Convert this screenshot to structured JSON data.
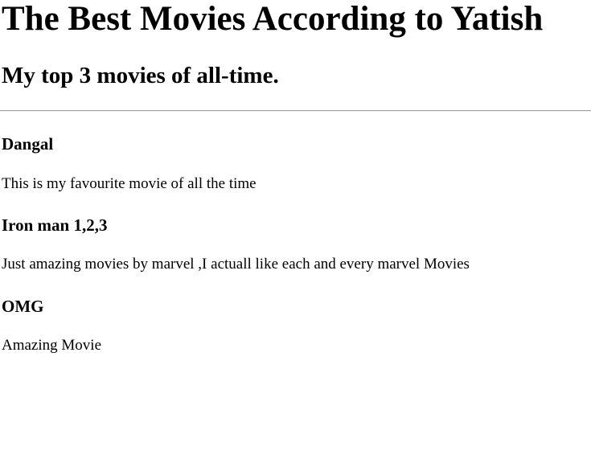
{
  "page": {
    "title": "The Best Movies According to Yatish",
    "subtitle": "My top 3 movies of all-time."
  },
  "movies": [
    {
      "title": "Dangal",
      "description": "This is my favourite movie of all the time"
    },
    {
      "title": "Iron man 1,2,3",
      "description": "Just amazing movies by marvel ,I actuall like each and every marvel Movies"
    },
    {
      "title": "OMG",
      "description": "Amazing Movie"
    }
  ]
}
